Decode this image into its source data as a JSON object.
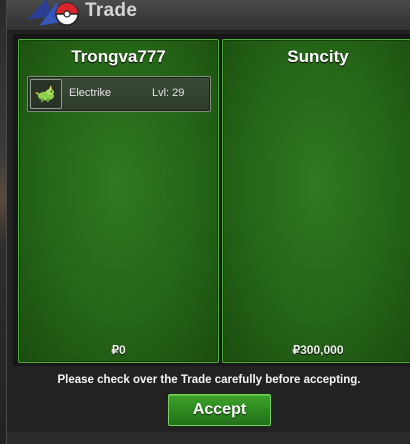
{
  "window": {
    "title": "Trade"
  },
  "left_player": {
    "name": "Trongva777",
    "money": "₽0",
    "items": [
      {
        "name": "Electrike",
        "level": "Lvl: 29",
        "icon": "electrike-icon"
      }
    ]
  },
  "right_player": {
    "name": "Suncity",
    "money": "₽300,000"
  },
  "footer": {
    "notice": "Please check over the Trade carefully before accepting.",
    "accept_label": "Accept"
  },
  "colors": {
    "panel_green": "#256517",
    "panel_border": "#4fae37",
    "button_green": "#2d8a1f"
  }
}
